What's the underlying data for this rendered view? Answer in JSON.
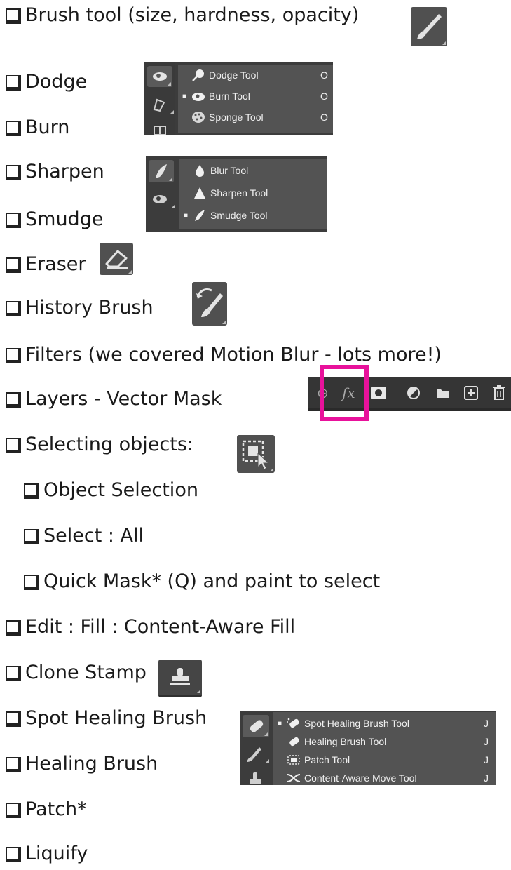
{
  "checklist": [
    {
      "label": "Brush tool (size, hardness, opacity)"
    },
    {
      "label": "Dodge"
    },
    {
      "label": "Burn"
    },
    {
      "label": "Sharpen"
    },
    {
      "label": "Smudge"
    },
    {
      "label": "Eraser"
    },
    {
      "label": "History Brush"
    },
    {
      "label": "Filters (we covered Motion Blur - lots more!)"
    },
    {
      "label": "Layers - Vector Mask"
    },
    {
      "label": "Selecting objects:"
    },
    {
      "label": "Object Selection"
    },
    {
      "label": "Select : All"
    },
    {
      "label": "Quick Mask* (Q) and paint to select"
    },
    {
      "label": "Edit : Fill : Content-Aware Fill"
    },
    {
      "label": "Clone Stamp"
    },
    {
      "label": "Spot Healing Brush"
    },
    {
      "label": "Healing Brush"
    },
    {
      "label": "Patch*"
    },
    {
      "label": "Liquify"
    }
  ],
  "dodge_menu": {
    "items": [
      {
        "label": "Dodge Tool",
        "shortcut": "O",
        "icon": "dodge-icon"
      },
      {
        "label": "Burn Tool",
        "shortcut": "O",
        "icon": "burn-icon",
        "selected": true
      },
      {
        "label": "Sponge Tool",
        "shortcut": "O",
        "icon": "sponge-icon"
      }
    ]
  },
  "blur_menu": {
    "items": [
      {
        "label": "Blur Tool",
        "icon": "blur-icon"
      },
      {
        "label": "Sharpen Tool",
        "icon": "sharpen-icon"
      },
      {
        "label": "Smudge Tool",
        "icon": "smudge-icon",
        "selected": true
      }
    ]
  },
  "layers_bar": {
    "fx_label": "fx",
    "icons": [
      "link-icon",
      "fx-icon",
      "vector-mask-icon",
      "adjustment-icon",
      "folder-icon",
      "new-layer-icon",
      "trash-icon"
    ],
    "highlight_color": "#e8129b"
  },
  "healing_menu": {
    "items": [
      {
        "label": "Spot Healing Brush Tool",
        "shortcut": "J",
        "icon": "spot-healing-icon",
        "selected": true
      },
      {
        "label": "Healing Brush Tool",
        "shortcut": "J",
        "icon": "healing-brush-icon"
      },
      {
        "label": "Patch Tool",
        "shortcut": "J",
        "icon": "patch-icon"
      },
      {
        "label": "Content-Aware Move Tool",
        "shortcut": "J",
        "icon": "content-aware-move-icon"
      }
    ]
  },
  "selected_marker": "■"
}
